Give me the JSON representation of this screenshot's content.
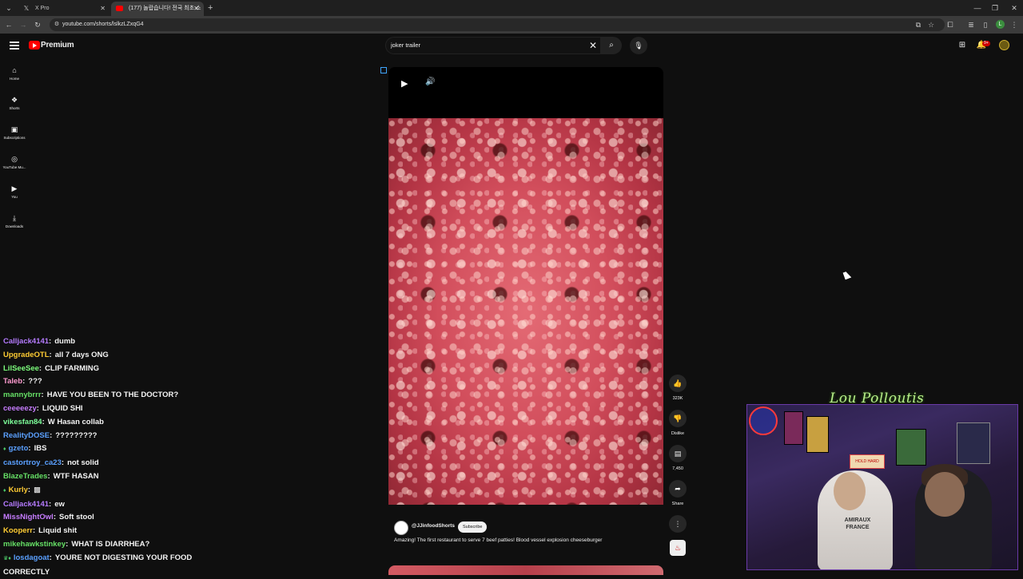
{
  "browser": {
    "tabs": [
      {
        "title": "X Pro",
        "active": false
      },
      {
        "title": "(177) 놀랍습니다! 전국 최초 소",
        "active": true
      }
    ],
    "url": "youtube.com/shorts/lslkzLZxqG4",
    "profile_initial": "L"
  },
  "header": {
    "brand": "Premium",
    "search_query": "joker trailer",
    "notifications": "9+"
  },
  "sidebar": {
    "items": [
      {
        "label": "Home",
        "icon": "home-icon"
      },
      {
        "label": "Shorts",
        "icon": "shorts-icon"
      },
      {
        "label": "Subscriptions",
        "icon": "subscriptions-icon"
      },
      {
        "label": "YouTube Mu...",
        "icon": "youtube-music-icon"
      },
      {
        "label": "You",
        "icon": "you-icon"
      },
      {
        "label": "Downloads",
        "icon": "downloads-icon"
      }
    ]
  },
  "short": {
    "channel": "@JJinfoodShorts",
    "subscribe_label": "Subscribe",
    "title": "Amazing! The first restaurant to serve 7 beef patties! Blood vessel explosion cheeseburger",
    "actions": {
      "likes": "323K",
      "dislike_label": "Dislike",
      "comments": "7,450",
      "share_label": "Share"
    }
  },
  "chat": [
    {
      "user": "Calljack4141",
      "color": "#b57bff",
      "msg": "dumb",
      "badge": ""
    },
    {
      "user": "UpgradeOTL",
      "color": "#ffcc33",
      "msg": "all 7 days ONG",
      "badge": ""
    },
    {
      "user": "LilSeeSee",
      "color": "#7dff7d",
      "msg": "CLIP FARMING",
      "badge": ""
    },
    {
      "user": "Taleb",
      "color": "#ff9bd0",
      "msg": "???",
      "badge": ""
    },
    {
      "user": "mannybrrr",
      "color": "#66e066",
      "msg": "HAVE YOU BEEN TO THE DOCTOR?",
      "badge": ""
    },
    {
      "user": "ceeeeezy",
      "color": "#c77dff",
      "msg": "LIQUID SHI",
      "badge": ""
    },
    {
      "user": "vikesfan84",
      "color": "#7dff9a",
      "msg": "W Hasan collab",
      "badge": ""
    },
    {
      "user": "RealityDOSE",
      "color": "#5aa0ff",
      "msg": "?????????",
      "badge": ""
    },
    {
      "user": "gzeto",
      "color": "#5aa0ff",
      "msg": "IBS",
      "badge": "♦"
    },
    {
      "user": "castortroy_ca23",
      "color": "#5aa0ff",
      "msg": "not solid",
      "badge": ""
    },
    {
      "user": "BlazeTrades",
      "color": "#66e066",
      "msg": "WTF HASAN",
      "badge": ""
    },
    {
      "user": "Kurly",
      "color": "#ffcc33",
      "msg": "▩",
      "badge": "♦"
    },
    {
      "user": "Calljack4141",
      "color": "#b57bff",
      "msg": "ew",
      "badge": ""
    },
    {
      "user": "MissNightOwl",
      "color": "#c77dff",
      "msg": "Soft stool",
      "badge": ""
    },
    {
      "user": "Kooperr",
      "color": "#ffcc33",
      "msg": "Liquid shit",
      "badge": ""
    },
    {
      "user": "mikehawkstinkey",
      "color": "#66e066",
      "msg": "WHAT IS DIARRHEA?",
      "badge": ""
    },
    {
      "user": "losdagoat",
      "color": "#5aa0ff",
      "msg": "YOURE NOT DIGESTING YOUR FOOD",
      "badge": "♛♦"
    },
    {
      "user": "",
      "color": "#f5f5f5",
      "msg": "CORRECTLY",
      "badge": ""
    }
  ],
  "webcam": {
    "signature": "Lou Polloutis",
    "lamp_text": "HOLD HARD",
    "shirt_text": "AMIRAUX FRANCE"
  }
}
